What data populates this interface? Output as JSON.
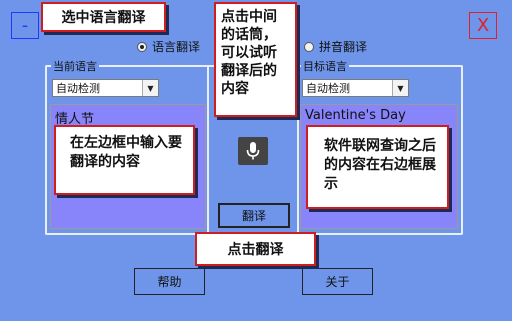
{
  "window": {
    "minimize_label": "-",
    "close_label": "X"
  },
  "mode": {
    "text_translate": "语言翻译",
    "pinyin_translate": "拼音翻译",
    "selected": "text_translate"
  },
  "source": {
    "group_title": "当前语言",
    "language": "自动检测",
    "text": "情人节"
  },
  "target": {
    "group_title": "目标语言",
    "language": "自动检测",
    "text": "Valentine's Day"
  },
  "buttons": {
    "translate": "翻译",
    "help": "帮助",
    "about": "关于"
  },
  "icons": {
    "mic": "microphone-icon"
  },
  "callouts": {
    "select_mode": "选中语言翻译",
    "listen": "点击中间的话筒，可以试听翻译后的内容",
    "input": "在左边框中输入要翻译的内容",
    "output": "软件联网查询之后的内容在右边框展示",
    "click_translate": "点击翻译"
  },
  "colors": {
    "background": "#6f95ea",
    "text_area": "#8884fa",
    "callout_border": "#d01e1e",
    "close": "#e0202a",
    "minimize": "#1a3cff"
  }
}
